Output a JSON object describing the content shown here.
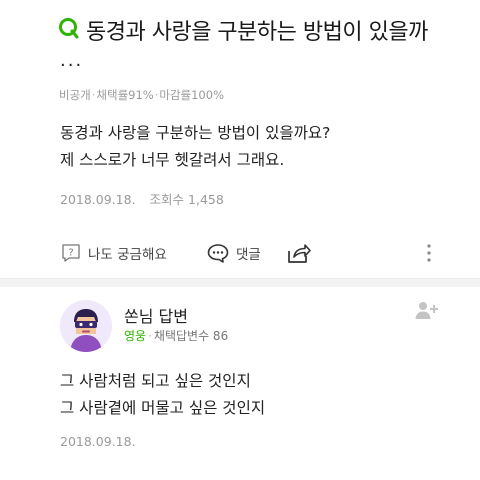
{
  "question": {
    "title": "동경과 사랑을 구분하는 방법이 있을까",
    "title_overflow": "...",
    "meta": {
      "visibility": "비공개",
      "adoption_rate": "채택률91%",
      "deadline_rate": "마감률100%"
    },
    "body": [
      "동경과 사랑을 구분하는 방법이 있을까요?",
      "제 스스로가 너무 헷갈려서 그래요."
    ],
    "date": "2018.09.18.",
    "views": "조회수 1,458"
  },
  "actions": {
    "curious_label": "나도 궁금해요",
    "comment_label": "댓글",
    "share_icon": "share-icon",
    "more_icon": "more-vertical-icon"
  },
  "answer": {
    "author": "쏜님 답변",
    "grade": "영웅",
    "adopted_count": "채택답변수 86",
    "body": [
      "그 사람처럼 되고 싶은 것인지",
      "그 사람곁에 머물고 싶은 것인지"
    ],
    "date": "2018.09.18."
  },
  "colors": {
    "brand_green": "#2db400",
    "meta_gray": "#9a9a9a"
  }
}
